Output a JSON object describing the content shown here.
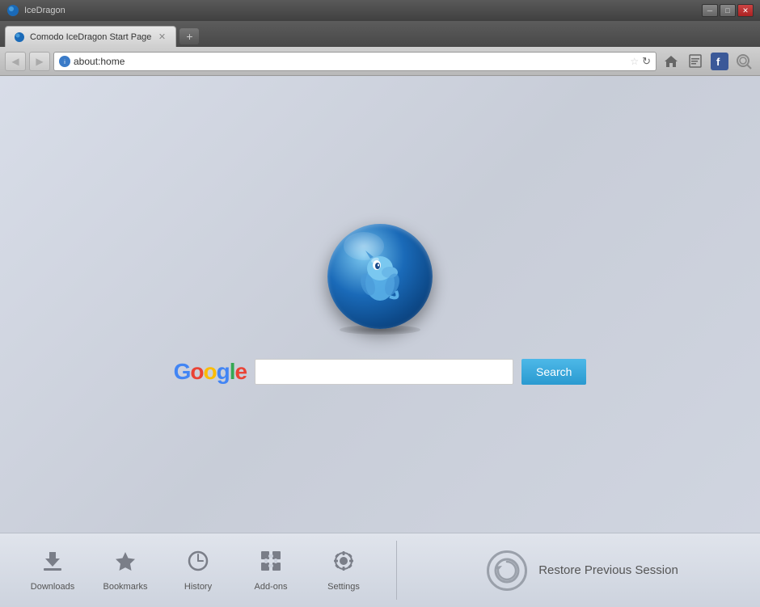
{
  "titlebar": {
    "app_name": "IceDragon",
    "minimize": "─",
    "maximize": "□",
    "close": "✕"
  },
  "tab": {
    "title": "Comodo IceDragon Start Page",
    "favicon": "🌐",
    "new_tab_label": "+"
  },
  "navbar": {
    "back_label": "◀",
    "forward_label": "▶",
    "address": "about:home",
    "star": "☆",
    "refresh": "↻"
  },
  "main": {
    "google_logo": {
      "G": "G",
      "o1": "o",
      "o2": "o",
      "g": "g",
      "l": "l",
      "e": "e"
    },
    "search_placeholder": "",
    "search_button_label": "Search"
  },
  "bottom_bar": {
    "quick_links": [
      {
        "id": "downloads",
        "label": "Downloads",
        "icon": "⬇"
      },
      {
        "id": "bookmarks",
        "label": "Bookmarks",
        "icon": "★"
      },
      {
        "id": "history",
        "label": "History",
        "icon": "🕐"
      },
      {
        "id": "addons",
        "label": "Add-ons",
        "icon": "🧩"
      },
      {
        "id": "settings",
        "label": "Settings",
        "icon": "⚙"
      }
    ],
    "restore_label": "Restore Previous Session"
  }
}
